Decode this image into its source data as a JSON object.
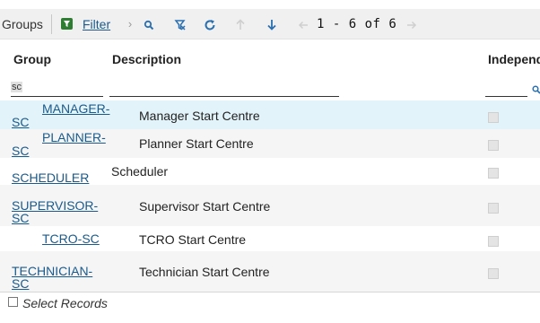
{
  "toolbar": {
    "title": "Groups",
    "filter_label": "Filter",
    "count_text": "1 - 6 of 6"
  },
  "columns": {
    "group": "Group",
    "description": "Description",
    "independent": "Independ"
  },
  "filters": {
    "group_value": "sc",
    "description_value": "",
    "independent_value": ""
  },
  "rows": [
    {
      "group_line1": "MANAGER-",
      "group_line2": "SC",
      "description": "Manager Start Centre",
      "independent": false,
      "selected": true
    },
    {
      "group_line1": "PLANNER-",
      "group_line2": "SC",
      "description": "Planner Start Centre",
      "independent": false,
      "selected": false
    },
    {
      "group_line1": "SCHEDULER",
      "group_line2": "",
      "description": "Scheduler",
      "independent": false,
      "selected": false
    },
    {
      "group_line1": "SUPERVISOR-",
      "group_line2": "SC",
      "description": "Supervisor Start Centre",
      "independent": false,
      "selected": false
    },
    {
      "group_line1": "TCRO-SC",
      "group_line2": "",
      "description": "TCRO Start Centre",
      "independent": false,
      "selected": false
    },
    {
      "group_line1": "TECHNICIAN-",
      "group_line2": "SC",
      "description": "Technician Start Centre",
      "independent": false,
      "selected": false
    }
  ],
  "footer": {
    "select_records_label": "Select Records"
  },
  "colors": {
    "link": "#1a5a8c",
    "selected_row": "#e3f3fa",
    "stripe_row": "#f5f5f5",
    "toolbar_bg": "#f0f0f0",
    "icon_blue": "#2a6fb0"
  }
}
